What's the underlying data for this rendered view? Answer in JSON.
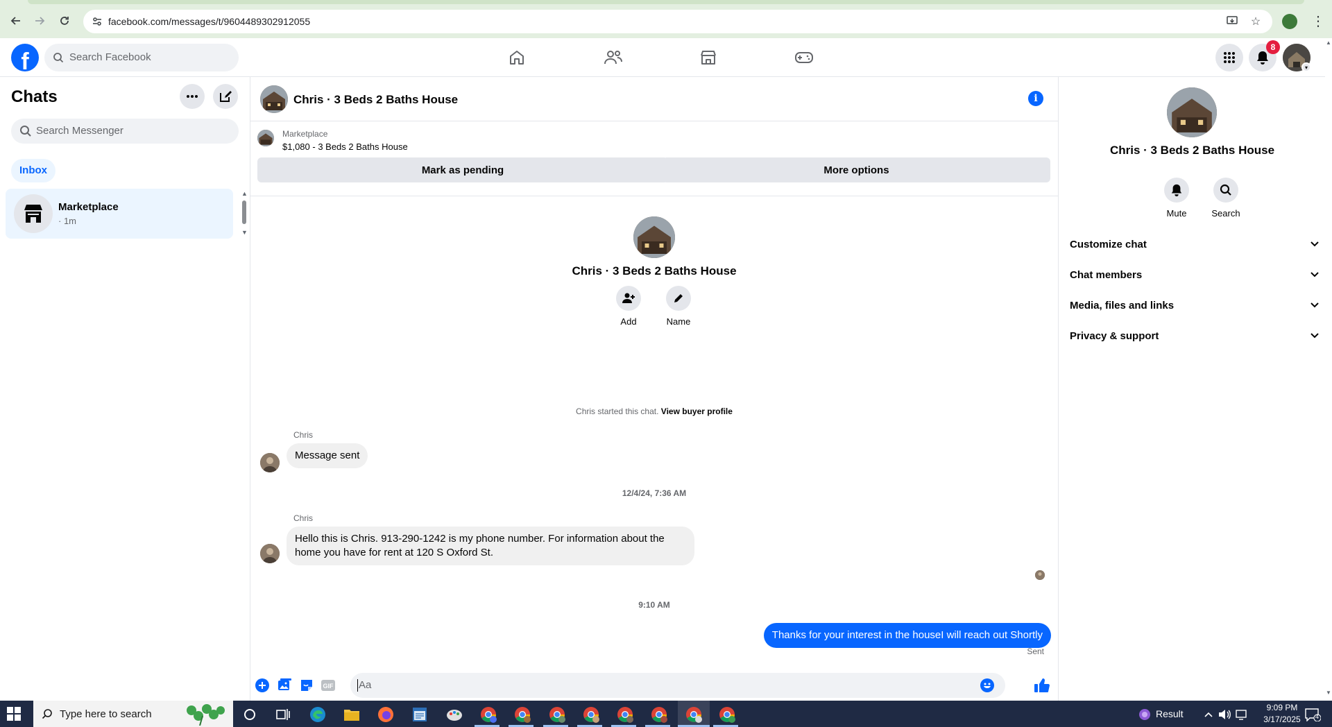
{
  "browser": {
    "url": "facebook.com/messages/t/9604489302912055"
  },
  "fb_header": {
    "search_placeholder": "Search Facebook",
    "notification_count": "8"
  },
  "sidebar": {
    "title": "Chats",
    "search_placeholder": "Search Messenger",
    "filter_label": "Inbox",
    "chats": [
      {
        "name": "Marketplace",
        "time": "· 1m"
      }
    ]
  },
  "conversation": {
    "title": "Chris · 3 Beds 2 Baths House",
    "marketplace": {
      "label": "Marketplace",
      "listing": "$1,080 - 3 Beds 2 Baths House",
      "pending_button": "Mark as pending",
      "options_button": "More options"
    },
    "profile": {
      "name": "Chris · 3 Beds 2 Baths House",
      "add_label": "Add",
      "name_label": "Name"
    },
    "system_line": {
      "text": "Chris started this chat.",
      "link": "View buyer profile"
    },
    "messages": [
      {
        "sender": "Chris",
        "text": "Message sent"
      },
      {
        "timestamp": "12/4/24, 7:36 AM"
      },
      {
        "sender": "Chris",
        "text_line1": "Hello this is Chris.  913-290-1242 is my phone number.  For information about the",
        "text_line2": "home you have for rent at 120 S Oxford St."
      },
      {
        "timestamp": "9:10 AM"
      },
      {
        "sender": "me",
        "text": "Thanks for your interest in the houseI will reach out Shortly",
        "status": "Sent"
      }
    ],
    "composer_placeholder": "Aa"
  },
  "right_panel": {
    "name": "Chris · 3 Beds 2 Baths House",
    "mute_label": "Mute",
    "search_label": "Search",
    "sections": [
      "Customize chat",
      "Chat members",
      "Media, files and links",
      "Privacy & support"
    ]
  },
  "taskbar": {
    "search_placeholder": "Type here to search",
    "tray_label": "Result",
    "time": "9:09 PM",
    "date": "3/17/2025",
    "notification_count": "4"
  },
  "colors": {
    "brand_blue": "#0866ff",
    "bubble_in": "#f0f0f0",
    "selected_bg": "#ebf5ff",
    "badge_red": "#e41e3f"
  }
}
